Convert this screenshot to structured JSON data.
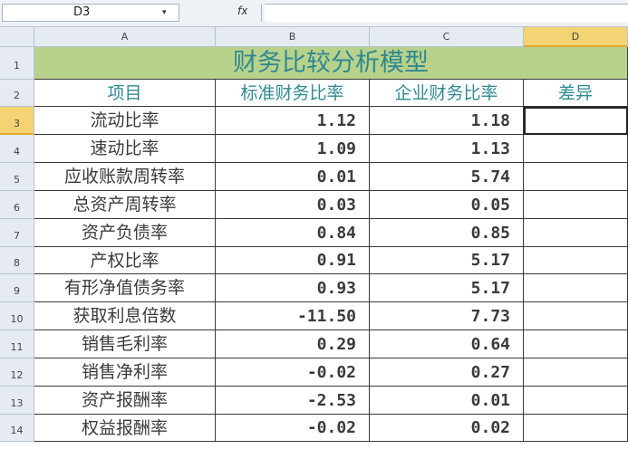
{
  "formula_bar": {
    "cell_ref": "D3",
    "dropdown_glyph": "▾",
    "fx_label": "fx",
    "formula_value": ""
  },
  "columns": [
    "A",
    "B",
    "C",
    "D"
  ],
  "rows": [
    "1",
    "2",
    "3",
    "4",
    "5",
    "6",
    "7",
    "8",
    "9",
    "10",
    "11",
    "12",
    "13",
    "14"
  ],
  "sheet": {
    "title": "财务比较分析模型",
    "headers": [
      "项目",
      "标准财务比率",
      "企业财务比率",
      "差异"
    ],
    "data": [
      {
        "item": "流动比率",
        "standard": "1.12",
        "company": "1.18",
        "diff": ""
      },
      {
        "item": "速动比率",
        "standard": "1.09",
        "company": "1.13",
        "diff": ""
      },
      {
        "item": "应收账款周转率",
        "standard": "0.01",
        "company": "5.74",
        "diff": ""
      },
      {
        "item": "总资产周转率",
        "standard": "0.03",
        "company": "0.05",
        "diff": ""
      },
      {
        "item": "资产负债率",
        "standard": "0.84",
        "company": "0.85",
        "diff": ""
      },
      {
        "item": "产权比率",
        "standard": "0.91",
        "company": "5.17",
        "diff": ""
      },
      {
        "item": "有形净值债务率",
        "standard": "0.93",
        "company": "5.17",
        "diff": ""
      },
      {
        "item": "获取利息倍数",
        "standard": "-11.50",
        "company": "7.73",
        "diff": ""
      },
      {
        "item": "销售毛利率",
        "standard": "0.29",
        "company": "0.64",
        "diff": ""
      },
      {
        "item": "销售净利率",
        "standard": "-0.02",
        "company": "0.27",
        "diff": ""
      },
      {
        "item": "资产报酬率",
        "standard": "-2.53",
        "company": "0.01",
        "diff": ""
      },
      {
        "item": "权益报酬率",
        "standard": "-0.02",
        "company": "0.02",
        "diff": ""
      }
    ]
  },
  "selected_cell": "D3",
  "colors": {
    "title_fill": "#b8d28c",
    "title_text": "#2e8890",
    "header_text": "#2f8a93",
    "selected_header": "#f4d374"
  }
}
